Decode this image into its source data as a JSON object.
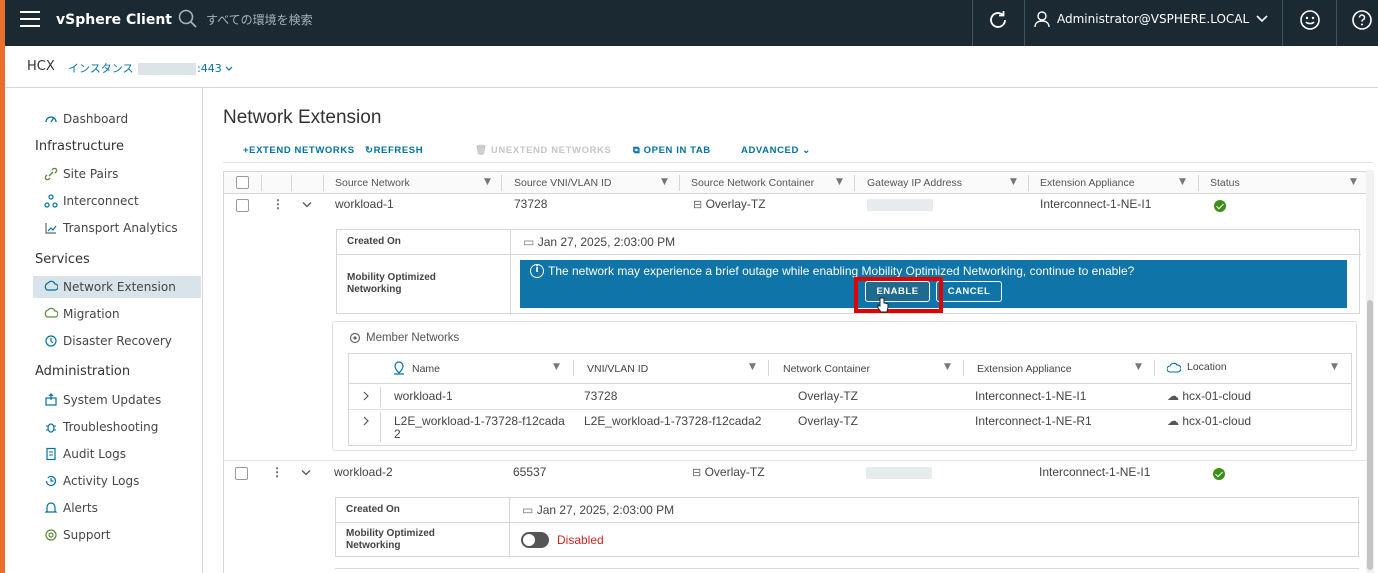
{
  "header": {
    "app_title": "vSphere Client",
    "search_placeholder": "すべての環境を検索",
    "user": "Administrator@VSPHERE.LOCAL"
  },
  "instance_bar": {
    "product": "HCX",
    "instance_label": "インスタンス",
    "port": ":443"
  },
  "sidebar": {
    "dashboard": "Dashboard",
    "sections": [
      {
        "title": "Infrastructure",
        "items": [
          "Site Pairs",
          "Interconnect",
          "Transport Analytics"
        ]
      },
      {
        "title": "Services",
        "items": [
          "Network Extension",
          "Migration",
          "Disaster Recovery"
        ]
      },
      {
        "title": "Administration",
        "items": [
          "System Updates",
          "Troubleshooting",
          "Audit Logs",
          "Activity Logs",
          "Alerts",
          "Support"
        ]
      }
    ],
    "active_item": "Network Extension"
  },
  "page": {
    "title": "Network Extension",
    "toolbar": {
      "extend": "EXTEND NETWORKS",
      "refresh": "REFRESH",
      "unextend": "UNEXTEND NETWORKS",
      "open_tab": "OPEN IN TAB",
      "advanced": "ADVANCED"
    },
    "columns": [
      "Source Network",
      "Source VNI/VLAN ID",
      "Source Network Container",
      "Gateway IP Address",
      "Extension Appliance",
      "Status"
    ],
    "rows": [
      {
        "network": "workload-1",
        "vni": "73728",
        "container": "Overlay-TZ",
        "appliance": "Interconnect-1-NE-I1",
        "status": "ok"
      },
      {
        "network": "workload-2",
        "vni": "65537",
        "container": "Overlay-TZ",
        "appliance": "Interconnect-1-NE-I1",
        "status": "ok"
      }
    ],
    "detail_1": {
      "created_on_label": "Created On",
      "created_on": "Jan 27, 2025, 2:03:00 PM",
      "mon_label_1": "Mobility Optimized",
      "mon_label_2": "Networking",
      "alert": "The network may experience a brief outage while enabling Mobility Optimized Networking, continue to enable?",
      "enable": "ENABLE",
      "cancel": "CANCEL"
    },
    "member_networks": {
      "title": "Member Networks",
      "columns": [
        "Name",
        "VNI/VLAN ID",
        "Network Container",
        "Extension Appliance",
        "Location"
      ],
      "rows": [
        {
          "name": "workload-1",
          "vni": "73728",
          "container": "Overlay-TZ",
          "appliance": "Interconnect-1-NE-I1",
          "location": "hcx-01-cloud"
        },
        {
          "name_1": "L2E_workload-1-73728-f12cada",
          "name_2": "2",
          "vni": "L2E_workload-1-73728-f12cada2",
          "container": "Overlay-TZ",
          "appliance": "Interconnect-1-NE-R1",
          "location": "hcx-01-cloud"
        }
      ]
    },
    "detail_2": {
      "created_on_label": "Created On",
      "created_on": "Jan 27, 2025, 2:03:00 PM",
      "mon_label_1": "Mobility Optimized",
      "mon_label_2": "Networking",
      "mon_status": "Disabled"
    }
  },
  "colors": {
    "header_bg": "#1b2a32",
    "accent": "#0072a3",
    "alert_bg": "#0f74a8",
    "highlight": "#e00000",
    "status_ok": "#3c8f17",
    "disabled_text": "#d1261f"
  }
}
